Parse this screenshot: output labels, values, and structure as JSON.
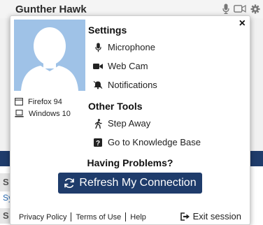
{
  "header": {
    "user_name": "Gunther Hawk"
  },
  "background": {
    "row1_initial": "S",
    "row2_text": "Sy",
    "row3_initial": "S"
  },
  "popup": {
    "close_label": "×",
    "system": {
      "browser": "Firefox 94",
      "os": "Windows 10"
    },
    "settings": {
      "heading": "Settings",
      "items": [
        {
          "label": "Microphone",
          "icon": "microphone-icon"
        },
        {
          "label": "Web Cam",
          "icon": "video-camera-icon"
        },
        {
          "label": "Notifications",
          "icon": "bell-icon"
        }
      ]
    },
    "other_tools": {
      "heading": "Other Tools",
      "items": [
        {
          "label": "Step Away",
          "icon": "walking-person-icon"
        },
        {
          "label": "Go to Knowledge Base",
          "icon": "question-icon"
        }
      ]
    },
    "problems_heading": "Having Problems?",
    "refresh_label": "Refresh My Connection",
    "footer": {
      "privacy": "Privacy Policy",
      "terms": "Terms of Use",
      "help": "Help"
    },
    "exit_label": "Exit session"
  },
  "colors": {
    "accent": "#1f3c6b",
    "avatar_bg": "#9fc2e7"
  }
}
